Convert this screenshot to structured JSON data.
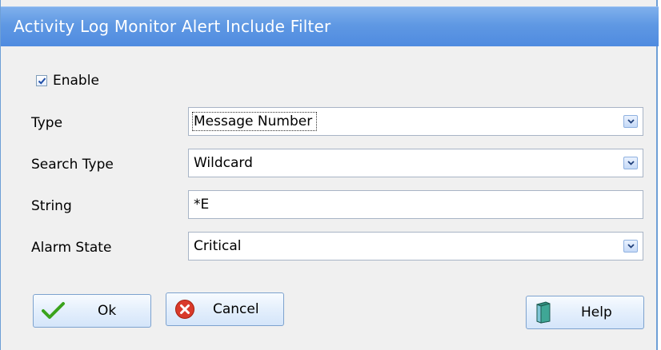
{
  "window": {
    "title": "Activity Log Monitor Alert Include Filter"
  },
  "enable": {
    "label": "Enable",
    "checked": true
  },
  "fields": {
    "type": {
      "label": "Type",
      "value": "Message Number"
    },
    "search_type": {
      "label": "Search Type",
      "value": "Wildcard"
    },
    "string": {
      "label": "String",
      "value": "*E"
    },
    "alarm_state": {
      "label": "Alarm State",
      "value": "Critical"
    }
  },
  "buttons": {
    "ok": "Ok",
    "cancel": "Cancel",
    "help": "Help"
  },
  "icons": {
    "ok": "green-check-icon",
    "cancel": "red-x-icon",
    "help": "book-icon",
    "dropdown": "chevron-down-icon"
  },
  "colors": {
    "titlebar": "#5f98e3",
    "border": "#6e9fd6",
    "client": "#f0f0f0"
  }
}
